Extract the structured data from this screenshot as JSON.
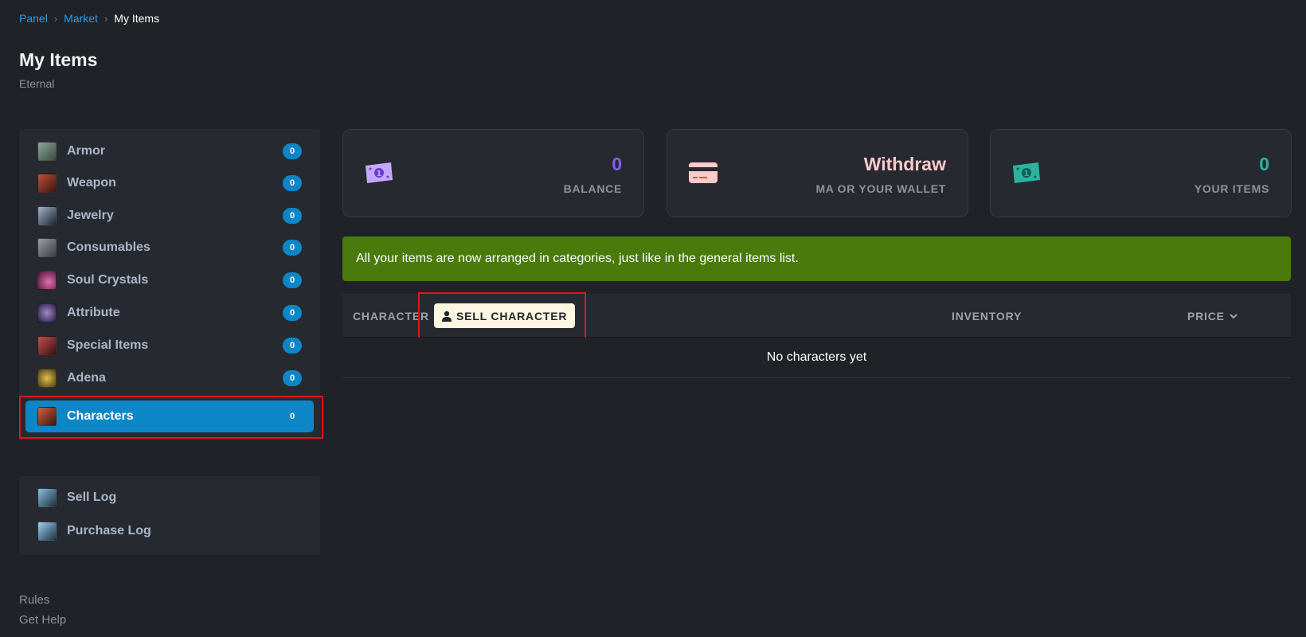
{
  "breadcrumb": {
    "items": [
      "Panel",
      "Market"
    ],
    "current": "My Items"
  },
  "page": {
    "title": "My Items",
    "subtitle": "Eternal"
  },
  "sidebar": {
    "items": [
      {
        "label": "Armor",
        "count": "0",
        "icon": "armor-icon",
        "color": "#5d7a6a"
      },
      {
        "label": "Weapon",
        "count": "0",
        "icon": "weapon-icon",
        "color": "#7a2a20"
      },
      {
        "label": "Jewelry",
        "count": "0",
        "icon": "jewelry-icon",
        "color": "#4a5a70"
      },
      {
        "label": "Consumables",
        "count": "0",
        "icon": "consumables-icon",
        "color": "#6a6e74"
      },
      {
        "label": "Soul Crystals",
        "count": "0",
        "icon": "soul-crystals-icon",
        "color": "#8a2e5a"
      },
      {
        "label": "Attribute",
        "count": "0",
        "icon": "attribute-icon",
        "color": "#6a4a8a"
      },
      {
        "label": "Special Items",
        "count": "0",
        "icon": "special-items-icon",
        "color": "#8a3030"
      },
      {
        "label": "Adena",
        "count": "0",
        "icon": "adena-icon",
        "color": "#8a7020"
      },
      {
        "label": "Characters",
        "count": "0",
        "icon": "characters-icon",
        "color": "#8a4030",
        "active": true
      }
    ],
    "logs": [
      {
        "label": "Sell Log",
        "icon": "sell-log-icon",
        "color": "#3a6a8a"
      },
      {
        "label": "Purchase Log",
        "icon": "purchase-log-icon",
        "color": "#4a7a9a"
      }
    ],
    "footer": [
      "Rules",
      "Get Help"
    ]
  },
  "stats": [
    {
      "value": "0",
      "label": "BALANCE",
      "color": "#8b5cf6",
      "icon": "money-icon"
    },
    {
      "value": "Withdraw",
      "label": "MA OR YOUR WALLET",
      "color": "#fecaca",
      "icon": "credit-card-icon"
    },
    {
      "value": "0",
      "label": "YOUR ITEMS",
      "color": "#2bb3a0",
      "icon": "money-icon"
    }
  ],
  "alert": {
    "text": "All your items are now arranged in categories, just like in the general items list."
  },
  "table": {
    "col_character": "CHARACTER",
    "sell_button": "SELL CHARACTER",
    "col_inventory": "INVENTORY",
    "col_price": "PRICE",
    "empty_text": "No characters yet"
  },
  "colors": {
    "accent": "#0d86c8",
    "link": "#2f9be8",
    "alert_bg": "#4a7a0c",
    "highlight": "#e0141e"
  }
}
